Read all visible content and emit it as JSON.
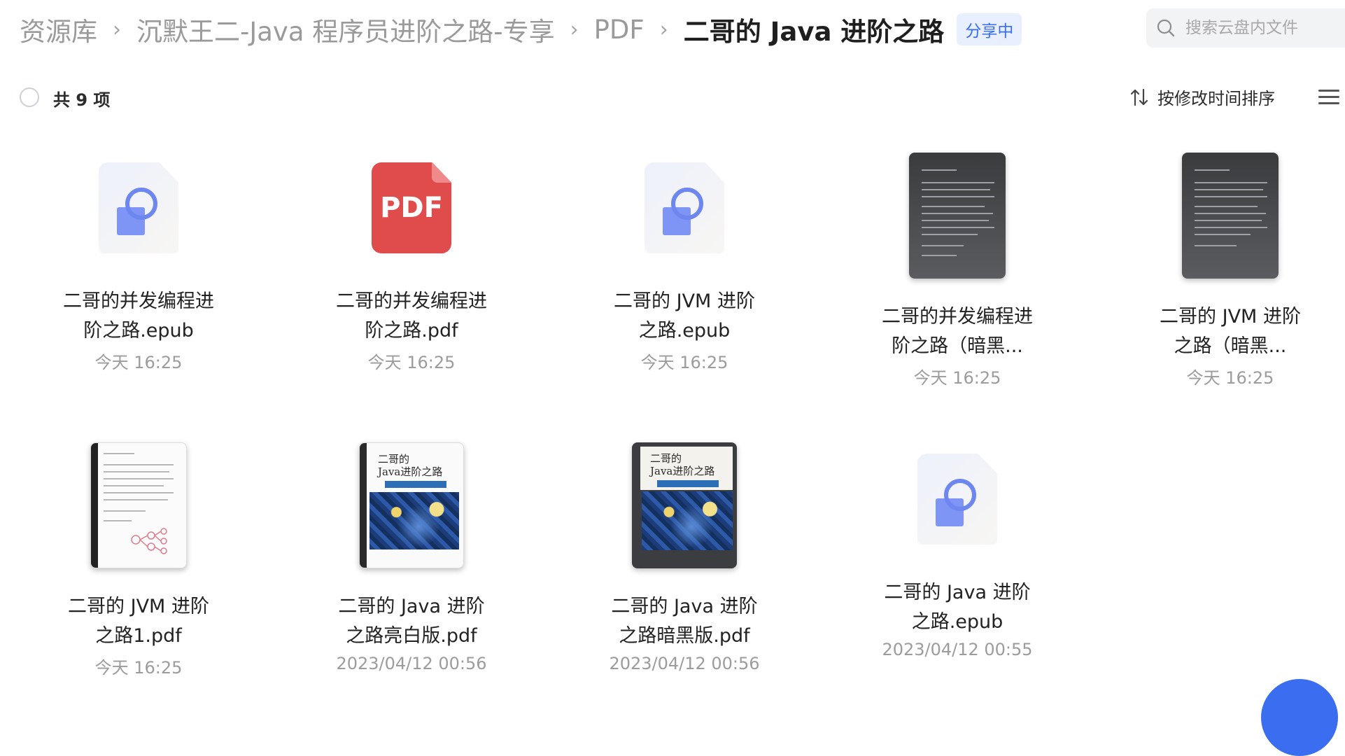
{
  "breadcrumb": {
    "items": [
      "资源库",
      "沉默王二-Java 程序员进阶之路-专享",
      "PDF"
    ],
    "current": "二哥的 Java 进阶之路",
    "separator": "›",
    "badge": "分享中"
  },
  "search": {
    "placeholder": "搜索云盘内文件"
  },
  "toolbar": {
    "count_label": "共 9 项",
    "sort_label": "按修改时间排序"
  },
  "colors": {
    "accent": "#3a6df0",
    "pdf_red": "#e04b4b",
    "muted_text": "#9c9c9c"
  },
  "files": [
    {
      "name": "二哥的并发编程进阶之路.epub",
      "date": "今天 16:25",
      "icon": "epub-icon"
    },
    {
      "name": "二哥的并发编程进阶之路.pdf",
      "date": "今天 16:25",
      "icon": "pdf-icon",
      "icon_text": "PDF"
    },
    {
      "name": "二哥的 JVM 进阶之路.epub",
      "date": "今天 16:25",
      "icon": "epub-icon"
    },
    {
      "name": "二哥的并发编程进阶之路（暗黑...",
      "date": "今天 16:25",
      "icon": "dark-document-thumbnail"
    },
    {
      "name": "二哥的 JVM 进阶之路（暗黑...",
      "date": "今天 16:25",
      "icon": "dark-document-thumbnail"
    },
    {
      "name": "二哥的 JVM 进阶之路1.pdf",
      "date": "今天 16:25",
      "icon": "light-document-thumbnail"
    },
    {
      "name": "二哥的 Java 进阶之路亮白版.pdf",
      "date": "2023/04/12 00:56",
      "icon": "light-book-cover"
    },
    {
      "name": "二哥的 Java 进阶之路暗黑版.pdf",
      "date": "2023/04/12 00:56",
      "icon": "dark-book-cover"
    },
    {
      "name": "二哥的 Java 进阶之路.epub",
      "date": "2023/04/12 00:55",
      "icon": "epub-icon"
    }
  ],
  "cover_title": [
    "二哥的",
    "Java进阶之路"
  ]
}
